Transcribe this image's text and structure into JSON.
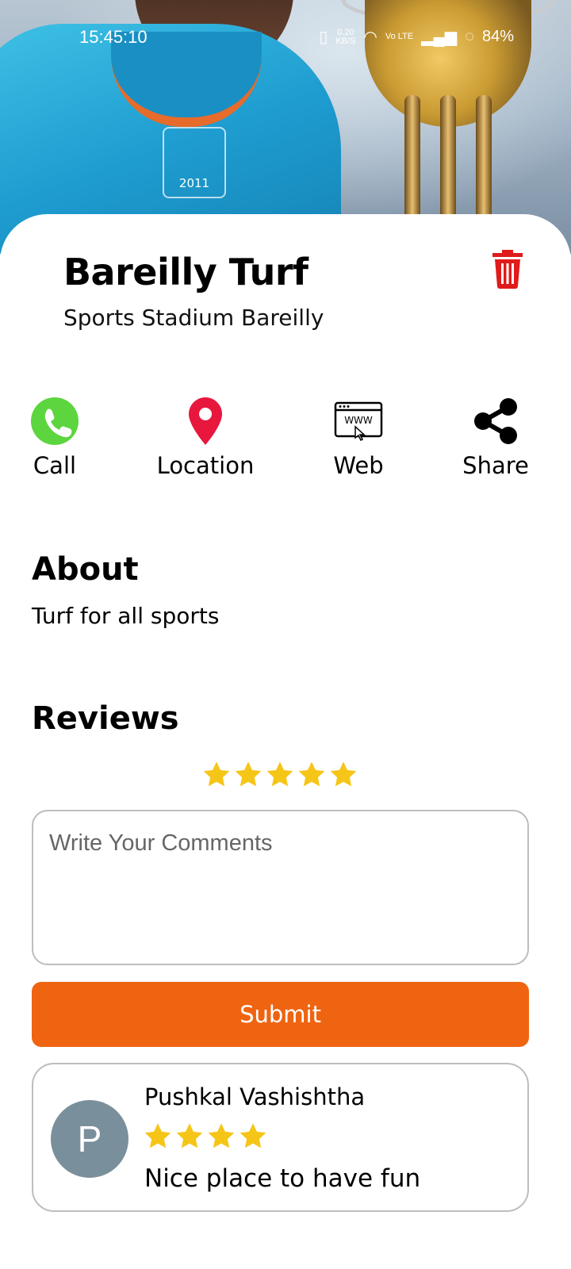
{
  "status_bar": {
    "time": "15:45:10",
    "net_speed_value": "0.20",
    "net_speed_unit": "KB/S",
    "carrier": "Vo LTE",
    "battery": "84%"
  },
  "venue": {
    "name": "Bareilly Turf",
    "subtitle": "Sports Stadium Bareilly"
  },
  "hero": {
    "jersey_text": "2011"
  },
  "actions": [
    {
      "label": "Call",
      "icon": "phone-icon",
      "color": "#5dd53f"
    },
    {
      "label": "Location",
      "icon": "location-pin-icon",
      "color": "#e8173d"
    },
    {
      "label": "Web",
      "icon": "web-icon",
      "color": "#000000"
    },
    {
      "label": "Share",
      "icon": "share-icon",
      "color": "#000000"
    }
  ],
  "about": {
    "heading": "About",
    "text": "Turf for all sports"
  },
  "reviews": {
    "heading": "Reviews",
    "input_rating": 5,
    "comment_placeholder": "Write Your Comments",
    "submit_label": "Submit",
    "items": [
      {
        "avatar_initial": "P",
        "name": "Pushkal Vashishtha",
        "rating": 4,
        "text": "Nice place to have fun"
      }
    ]
  },
  "colors": {
    "accent": "#ef6411",
    "star": "#f5c518",
    "delete": "#e01b1b",
    "avatar_bg": "#7a8f9c"
  }
}
